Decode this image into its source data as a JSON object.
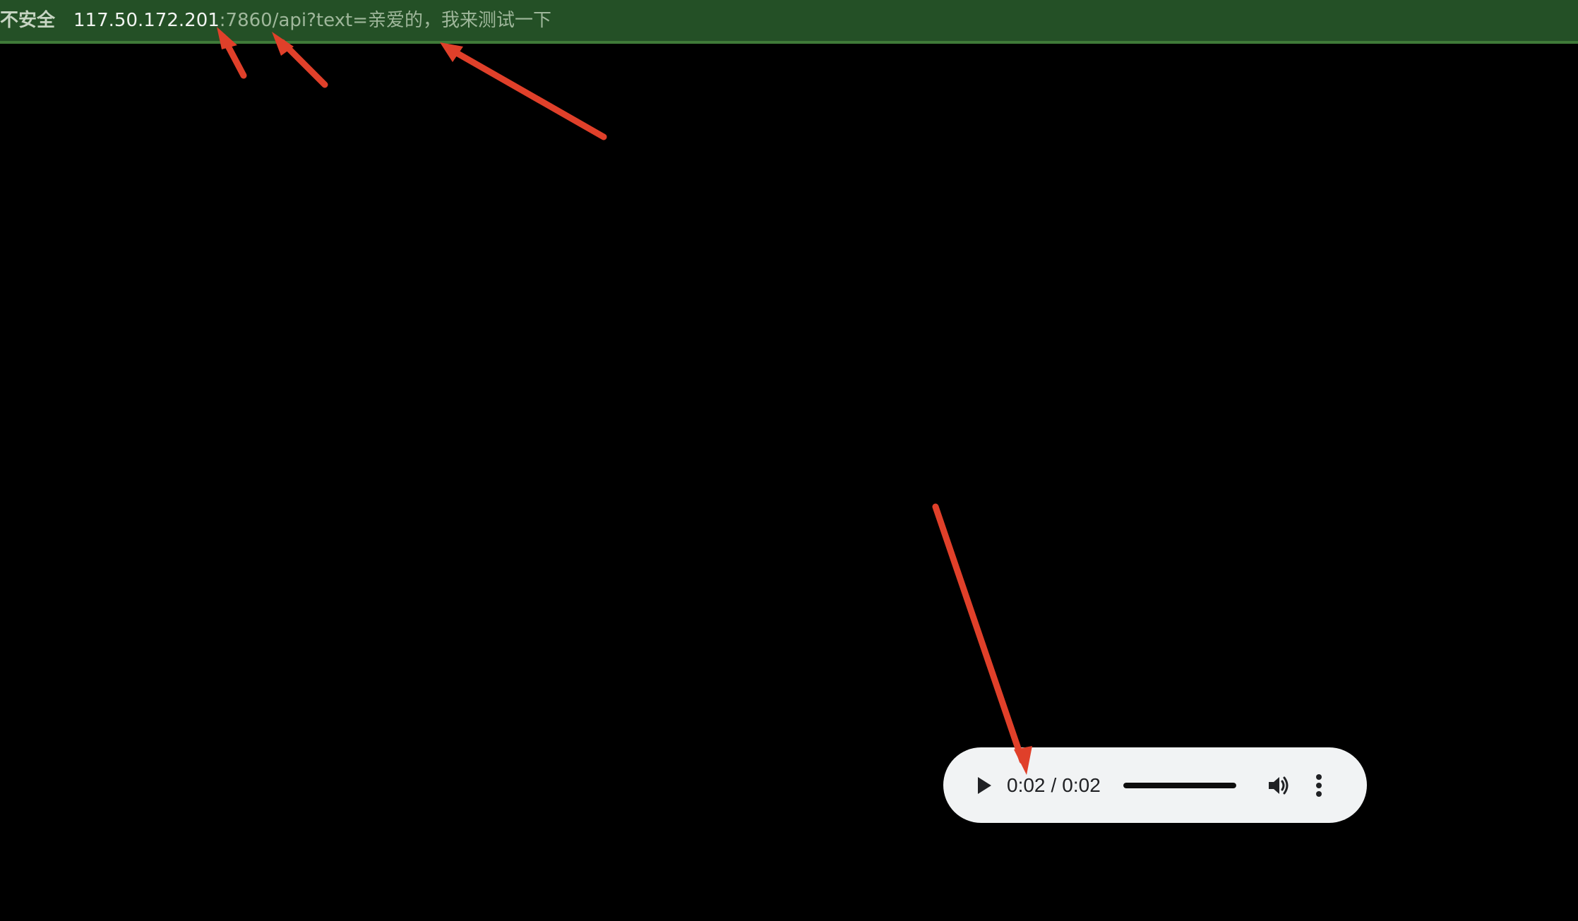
{
  "address_bar": {
    "security_label": "不安全",
    "url_host": "117.50.172.201",
    "url_rest": ":7860/api?text=亲爱的，我来测试一下"
  },
  "audio_player": {
    "current_time": "0:02",
    "separator": "/",
    "duration": "0:02",
    "progress_fraction": 1.0
  },
  "icons": {
    "play": "play-icon",
    "volume": "volume-icon",
    "more": "more-vertical-icon"
  },
  "colors": {
    "address_bar_bg": "#245026",
    "player_bg": "#f1f3f4",
    "annotation_arrow": "#e0402a"
  }
}
